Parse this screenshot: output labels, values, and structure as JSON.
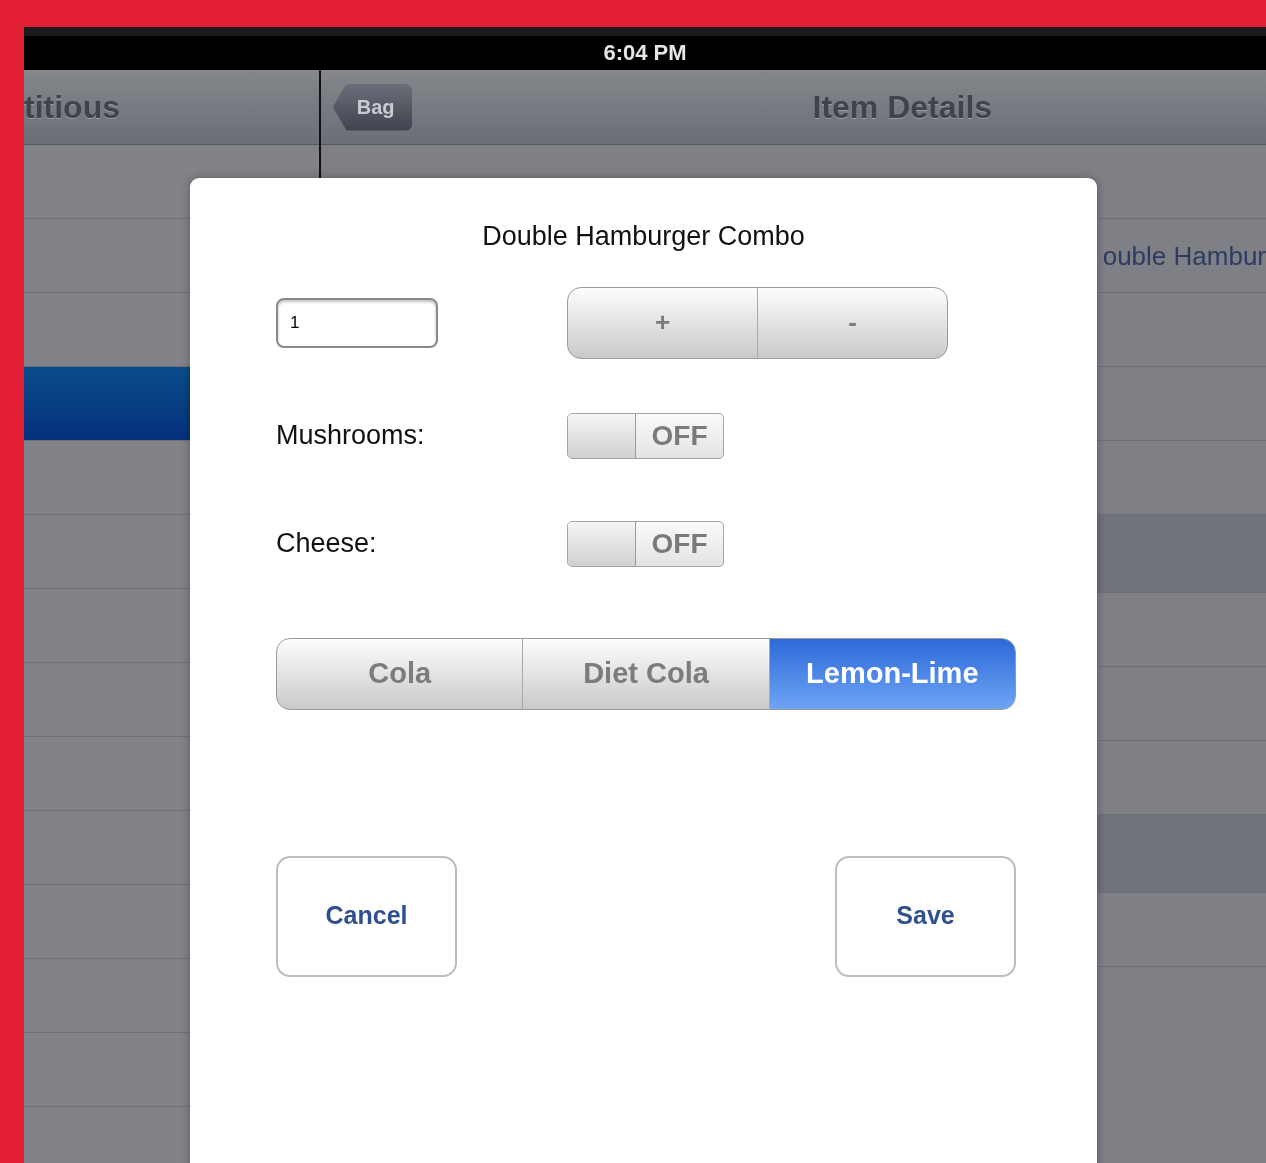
{
  "status_bar": {
    "time": "6:04 PM"
  },
  "master": {
    "title": "titious",
    "rows": [
      {
        "selected": false
      },
      {
        "selected": false
      },
      {
        "selected": false
      },
      {
        "selected": true
      },
      {
        "selected": false
      },
      {
        "selected": false
      },
      {
        "selected": false
      },
      {
        "selected": false
      },
      {
        "selected": false
      },
      {
        "selected": false
      },
      {
        "selected": false
      },
      {
        "selected": false
      },
      {
        "selected": false
      }
    ]
  },
  "detail": {
    "back_button": "Bag",
    "title": "Item Details",
    "rows": [
      {
        "kind": "blank"
      },
      {
        "kind": "text",
        "text": "ouble Hambur"
      },
      {
        "kind": "blank"
      },
      {
        "kind": "blank"
      },
      {
        "kind": "blank"
      },
      {
        "kind": "gap"
      },
      {
        "kind": "blank"
      },
      {
        "kind": "blank"
      },
      {
        "kind": "blank"
      },
      {
        "kind": "gap"
      },
      {
        "kind": "blank"
      }
    ]
  },
  "dialog": {
    "title": "Double Hamburger Combo",
    "quantity": {
      "value": "1"
    },
    "stepper": [
      "+",
      "-"
    ],
    "options": [
      {
        "label": "Mushrooms:",
        "on": false,
        "state_label": "OFF"
      },
      {
        "label": "Cheese:",
        "on": false,
        "state_label": "OFF"
      }
    ],
    "drinks": [
      {
        "label": "Cola",
        "selected": false
      },
      {
        "label": "Diet Cola",
        "selected": false
      },
      {
        "label": "Lemon-Lime",
        "selected": true
      }
    ],
    "buttons": [
      "Cancel",
      "Save"
    ]
  }
}
